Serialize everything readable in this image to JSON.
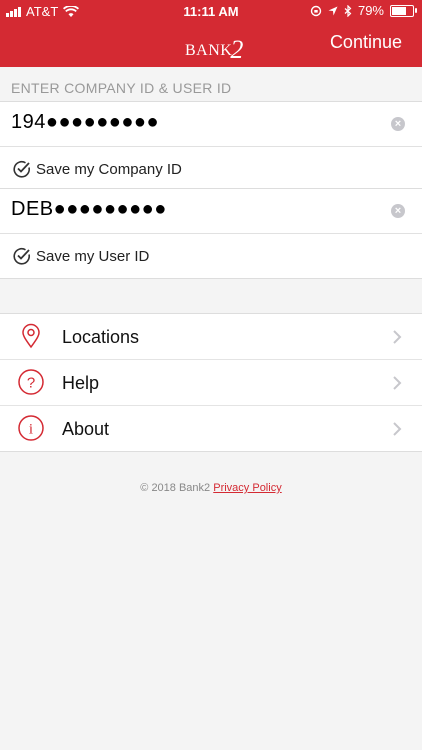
{
  "status_bar": {
    "carrier": "AT&T",
    "time": "11:11 AM",
    "battery": "79%",
    "battery_level": 0.79
  },
  "header": {
    "logo_text": "BANK",
    "logo_number": "2",
    "continue_label": "Continue"
  },
  "login": {
    "section_title": "ENTER COMPANY ID & USER ID",
    "company_id_value": "194●●●●●●●●●",
    "save_company_label": "Save my Company ID",
    "user_id_value": "DEB●●●●●●●●●",
    "save_user_label": "Save my User ID"
  },
  "menu": {
    "items": [
      {
        "label": "Locations",
        "icon": "location-pin-icon"
      },
      {
        "label": "Help",
        "icon": "question-icon"
      },
      {
        "label": "About",
        "icon": "info-icon"
      }
    ]
  },
  "footer": {
    "copyright": "© 2018 Bank2",
    "privacy_label": "Privacy Policy"
  },
  "colors": {
    "brand": "#d42a33",
    "background": "#f4f4f4"
  }
}
